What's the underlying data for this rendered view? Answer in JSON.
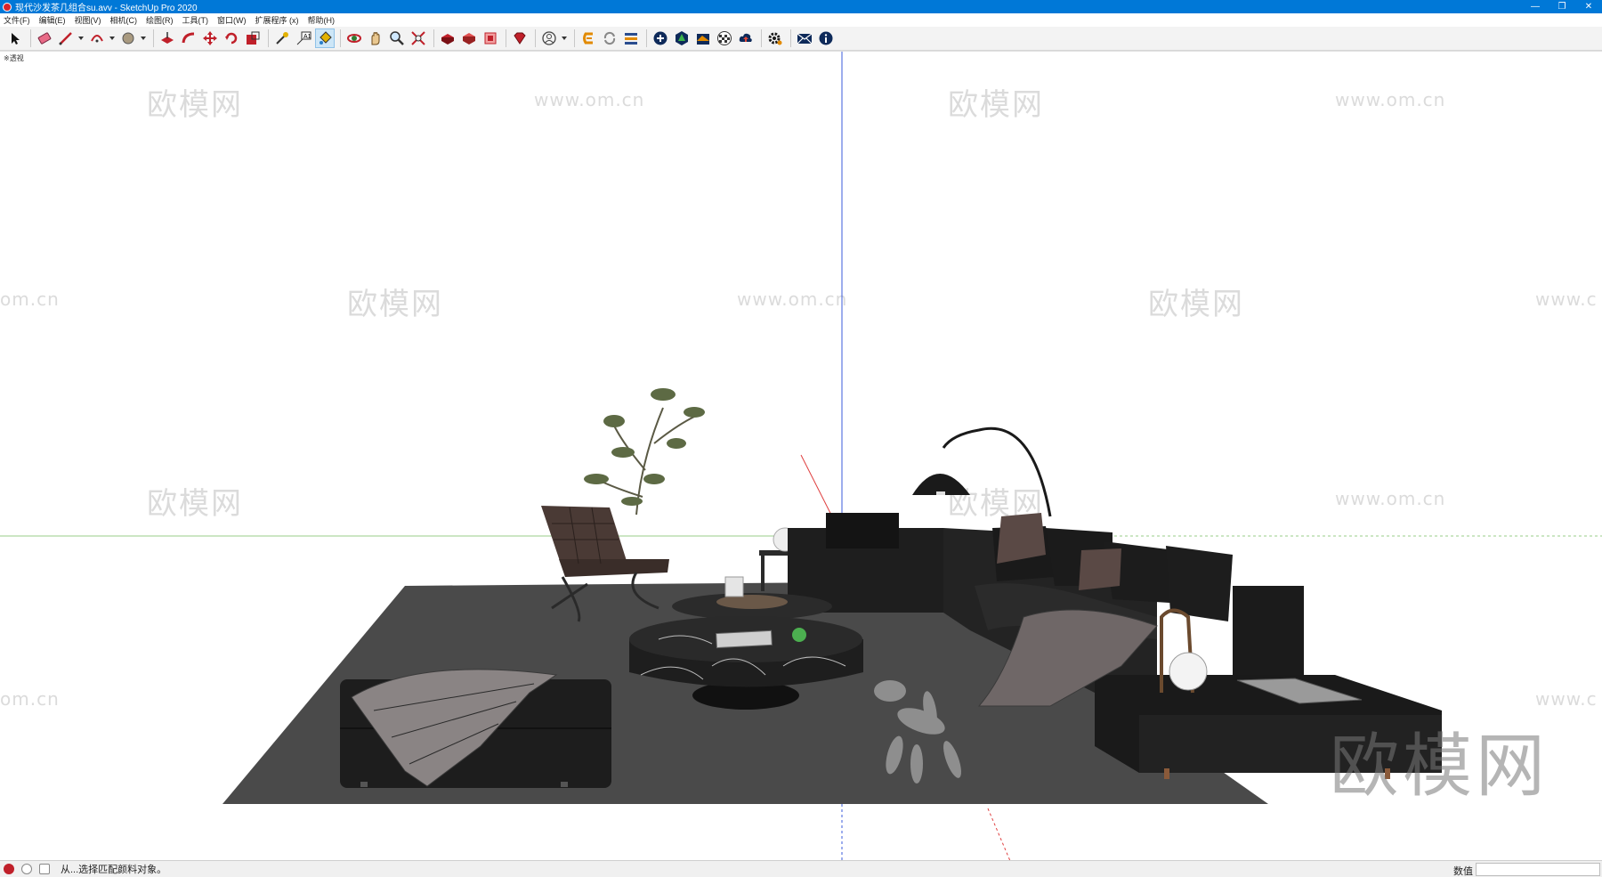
{
  "window": {
    "title": "现代沙发茶几组合su.avv - SketchUp Pro 2020",
    "minimize": "—",
    "restore": "❐",
    "close": "✕"
  },
  "menu": [
    "文件(F)",
    "编辑(E)",
    "视图(V)",
    "相机(C)",
    "绘图(R)",
    "工具(T)",
    "窗口(W)",
    "扩展程序 (x)",
    "帮助(H)"
  ],
  "toolbar": {
    "icons": [
      "select-icon",
      "eraser-icon",
      "line-icon",
      "arc-icon",
      "shapes-icon",
      "push-pull-icon",
      "follow-me-icon",
      "move-icon",
      "rotate-icon",
      "scale-icon",
      "tape-measure-icon",
      "text-icon",
      "paint-bucket-icon",
      "orbit-icon",
      "pan-icon",
      "zoom-icon",
      "zoom-extents-icon",
      "warehouse-icon",
      "extension-warehouse-icon",
      "layout-icon",
      "ruby-icon",
      "profile-icon",
      "plugin-logo-icon",
      "refresh-icon",
      "layers-icon",
      "add-circle-icon",
      "tree-icon",
      "material-icon",
      "checker-icon",
      "cloud-upload-icon",
      "settings-icon",
      "mail-icon",
      "info-icon"
    ]
  },
  "viewport": {
    "scene_label": "※透视",
    "watermark_cn": "欧模网",
    "watermark_url": "www.om.cn",
    "watermark_url_partial": "om.cn",
    "watermark_url_partial_right": "www.c",
    "big_watermark": "欧模网"
  },
  "status": {
    "message": "从...选择匹配颜料对象。",
    "measurements_label": "数值",
    "measurements_value": ""
  },
  "colors": {
    "titlebar": "#0078d7",
    "rug": "#4a4a4a",
    "sofa": "#1e1e1e",
    "green_axis": "#9acd8a",
    "blue_axis": "#3b5bdb",
    "red_axis": "#e04040"
  }
}
